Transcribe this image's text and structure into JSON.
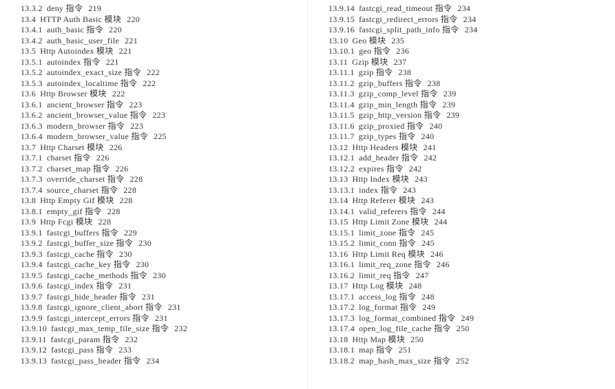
{
  "left_column": [
    {
      "sec": "13.3.2",
      "title": "deny 指令",
      "page": "219"
    },
    {
      "sec": "13.4",
      "title": "HTTP Auth Basic 模块",
      "page": "220"
    },
    {
      "sec": "13.4.1",
      "title": "auth_basic 指令",
      "page": "220"
    },
    {
      "sec": "13.4.2",
      "title": "auth_basic_user_file",
      "page": "221"
    },
    {
      "sec": "13.5",
      "title": "Http Autoindex 模块",
      "page": "221"
    },
    {
      "sec": "13.5.1",
      "title": "autoindex 指令",
      "page": "221"
    },
    {
      "sec": "13.5.2",
      "title": "autoindex_exact_size 指令",
      "page": "222"
    },
    {
      "sec": "13.5.3",
      "title": "autoindex_localtime 指令",
      "page": "222"
    },
    {
      "sec": "13.6",
      "title": "Http Browser 模块",
      "page": "222"
    },
    {
      "sec": "13.6.1",
      "title": "ancient_browser 指令",
      "page": "223"
    },
    {
      "sec": "13.6.2",
      "title": "ancient_browser_value 指令",
      "page": "223"
    },
    {
      "sec": "13.6.3",
      "title": "modern_browser 指令",
      "page": "223"
    },
    {
      "sec": "13.6.4",
      "title": "modern_browser_value 指令",
      "page": "225"
    },
    {
      "sec": "13.7",
      "title": "Http Charset 模块",
      "page": "226"
    },
    {
      "sec": "13.7.1",
      "title": "charset 指令",
      "page": "226"
    },
    {
      "sec": "13.7.2",
      "title": "charset_map 指令",
      "page": "226"
    },
    {
      "sec": "13.7.3",
      "title": "override_charset 指令",
      "page": "228"
    },
    {
      "sec": "13.7.4",
      "title": "source_charset 指令",
      "page": "228"
    },
    {
      "sec": "13.8",
      "title": "Http Empty Gif 模块",
      "page": "228"
    },
    {
      "sec": "13.8.1",
      "title": "empty_gif 指令",
      "page": "228"
    },
    {
      "sec": "13.9",
      "title": "Http Fcgi 模块",
      "page": "228"
    },
    {
      "sec": "13.9.1",
      "title": "fastcgi_buffers 指令",
      "page": "229"
    },
    {
      "sec": "13.9.2",
      "title": "fastcgi_buffer_size 指令",
      "page": "230"
    },
    {
      "sec": "13.9.3",
      "title": "fastcgi_cache 指令",
      "page": "230"
    },
    {
      "sec": "13.9.4",
      "title": "fastcgi_cache_key 指令",
      "page": "230"
    },
    {
      "sec": "13.9.5",
      "title": "fastcgi_cache_methods 指令",
      "page": "230"
    },
    {
      "sec": "13.9.6",
      "title": "fastcgi_index 指令",
      "page": "231"
    },
    {
      "sec": "13.9.7",
      "title": "fastcgi_hide_header 指令",
      "page": "231"
    },
    {
      "sec": "13.9.8",
      "title": "fastcgi_ignore_client_abort 指令",
      "page": "231"
    },
    {
      "sec": "13.9.9",
      "title": "fastcgi_intercept_errors 指令",
      "page": "231"
    },
    {
      "sec": "13.9.10",
      "title": "fastcgi_max_temp_file_size 指令",
      "page": "232"
    },
    {
      "sec": "13.9.11",
      "title": "fastcgi_param 指令",
      "page": "232"
    },
    {
      "sec": "13.9.12",
      "title": "fastcgi_pass 指令",
      "page": "233"
    },
    {
      "sec": "13.9.13",
      "title": "fastcgi_pass_header 指令",
      "page": "234"
    }
  ],
  "right_column": [
    {
      "sec": "13.9.14",
      "title": "fastcgi_read_timeout 指令",
      "page": "234"
    },
    {
      "sec": "13.9.15",
      "title": "fastcgi_redirect_errors 指令",
      "page": "234"
    },
    {
      "sec": "13.9.16",
      "title": "fastcgi_split_path_info 指令",
      "page": "234"
    },
    {
      "sec": "13.10",
      "title": "Geo 模块",
      "page": "235"
    },
    {
      "sec": "13.10.1",
      "title": "geo 指令",
      "page": "236"
    },
    {
      "sec": "13.11",
      "title": "Gzip 模块",
      "page": "237"
    },
    {
      "sec": "13.11.1",
      "title": "gzip 指令",
      "page": "238"
    },
    {
      "sec": "13.11.2",
      "title": "gzip_buffers 指令",
      "page": "238"
    },
    {
      "sec": "13.11.3",
      "title": "gzip_comp_level 指令",
      "page": "239"
    },
    {
      "sec": "13.11.4",
      "title": "gzip_min_length 指令",
      "page": "239"
    },
    {
      "sec": "13.11.5",
      "title": "gzip_http_version 指令",
      "page": "239"
    },
    {
      "sec": "13.11.6",
      "title": "gzip_proxied 指令",
      "page": "240"
    },
    {
      "sec": "13.11.7",
      "title": "gzip_types 指令",
      "page": "240"
    },
    {
      "sec": "13.12",
      "title": "Http Headers 模块",
      "page": "241"
    },
    {
      "sec": "13.12.1",
      "title": "add_header 指令",
      "page": "242"
    },
    {
      "sec": "13.12.2",
      "title": "expires 指令",
      "page": "242"
    },
    {
      "sec": "13.13",
      "title": "Http Index 模块",
      "page": "243"
    },
    {
      "sec": "13.13.1",
      "title": "index 指令",
      "page": "243"
    },
    {
      "sec": "13.14",
      "title": "Http Referer 模块",
      "page": "243"
    },
    {
      "sec": "13.14.1",
      "title": "valid_referers 指令",
      "page": "244"
    },
    {
      "sec": "13.15",
      "title": "Http Limit Zone 模块",
      "page": "244"
    },
    {
      "sec": "13.15.1",
      "title": "limit_zone 指令",
      "page": "245"
    },
    {
      "sec": "13.15.2",
      "title": "limit_conn 指令",
      "page": "245"
    },
    {
      "sec": "13.16",
      "title": "Http Limit Req 模块",
      "page": "246"
    },
    {
      "sec": "13.16.1",
      "title": "limit_req_zone 指令",
      "page": "246"
    },
    {
      "sec": "13.16.2",
      "title": "limit_req 指令",
      "page": "247"
    },
    {
      "sec": "13.17",
      "title": "Http Log 模块",
      "page": "248"
    },
    {
      "sec": "13.17.1",
      "title": "access_log 指令",
      "page": "248"
    },
    {
      "sec": "13.17.2",
      "title": "log_format 指令",
      "page": "249"
    },
    {
      "sec": "13.17.3",
      "title": "log_format_combined 指令",
      "page": "249"
    },
    {
      "sec": "13.17.4",
      "title": "open_log_file_cache 指令",
      "page": "250"
    },
    {
      "sec": "13.18",
      "title": "Http Map 模块",
      "page": "250"
    },
    {
      "sec": "13.18.1",
      "title": "map 指令",
      "page": "251"
    },
    {
      "sec": "13.18.2",
      "title": "map_hash_max_size 指令",
      "page": "252"
    }
  ]
}
